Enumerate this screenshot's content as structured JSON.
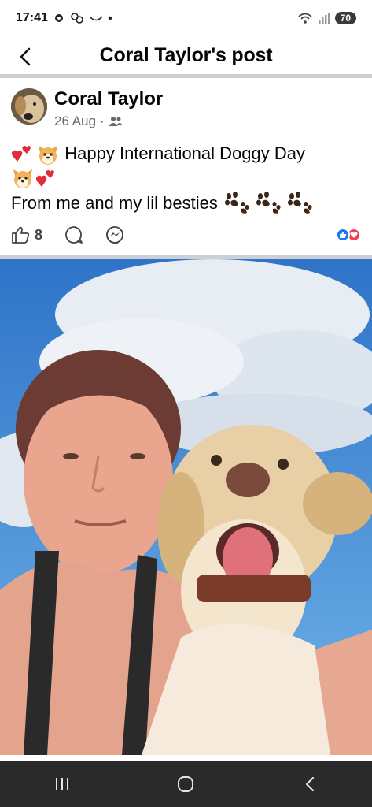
{
  "status_bar": {
    "time": "17:41",
    "battery": "70"
  },
  "header": {
    "title": "Coral Taylor's post"
  },
  "post": {
    "author": "Coral Taylor",
    "date": "26 Aug",
    "text_line1": "Happy International Doggy Day",
    "text_line3": "From me and my lil besties",
    "like_count": "8"
  },
  "colors": {
    "divider": "#ccd0d5",
    "meta_gray": "#65676b",
    "like_blue": "#1877f2",
    "love_red": "#f33e58",
    "navbar": "#2a2a2a"
  },
  "icons": {
    "back": "chevron-left-icon",
    "audience": "friends-icon",
    "like": "thumbs-up-icon",
    "comment": "comment-bubble-icon",
    "share": "messenger-icon"
  }
}
